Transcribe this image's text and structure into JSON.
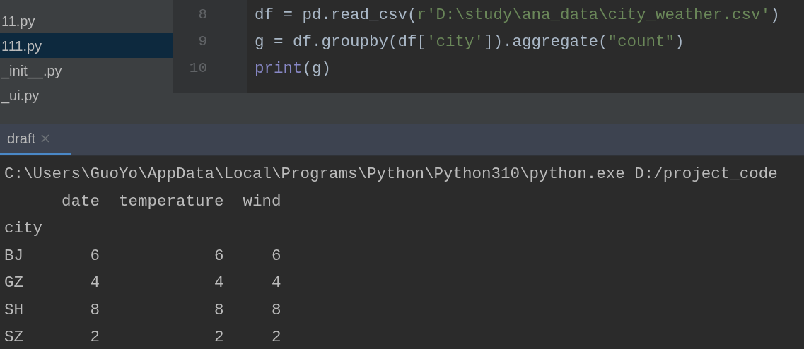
{
  "project_tree": {
    "files": [
      {
        "name": "11.py",
        "selected": false
      },
      {
        "name": "111.py",
        "selected": true
      },
      {
        "name": "_init__.py",
        "selected": false
      },
      {
        "name": "_ui.py",
        "selected": false
      }
    ]
  },
  "editor": {
    "lines": [
      {
        "number": "8",
        "tokens": [
          {
            "text": "df = pd.read_csv(",
            "kind": "plain"
          },
          {
            "text": "r'D:\\study\\ana_data\\city_weather.csv'",
            "kind": "string"
          },
          {
            "text": ")",
            "kind": "plain"
          }
        ]
      },
      {
        "number": "9",
        "tokens": [
          {
            "text": "g = df.groupby(df[",
            "kind": "plain"
          },
          {
            "text": "'city'",
            "kind": "string"
          },
          {
            "text": "]).aggregate(",
            "kind": "plain"
          },
          {
            "text": "\"count\"",
            "kind": "string"
          },
          {
            "text": ")",
            "kind": "plain"
          }
        ]
      },
      {
        "number": "10",
        "tokens": [
          {
            "text": "print",
            "kind": "builtin"
          },
          {
            "text": "(g)",
            "kind": "plain"
          }
        ]
      }
    ]
  },
  "run_tabs": [
    {
      "label": "draft",
      "selected": true
    }
  ],
  "console": {
    "lines": [
      "C:\\Users\\GuoYo\\AppData\\Local\\Programs\\Python\\Python310\\python.exe D:/project_code",
      "      date  temperature  wind",
      "city",
      "BJ       6            6     6",
      "GZ       4            4     4",
      "SH       8            8     8",
      "SZ       2            2     2"
    ]
  }
}
